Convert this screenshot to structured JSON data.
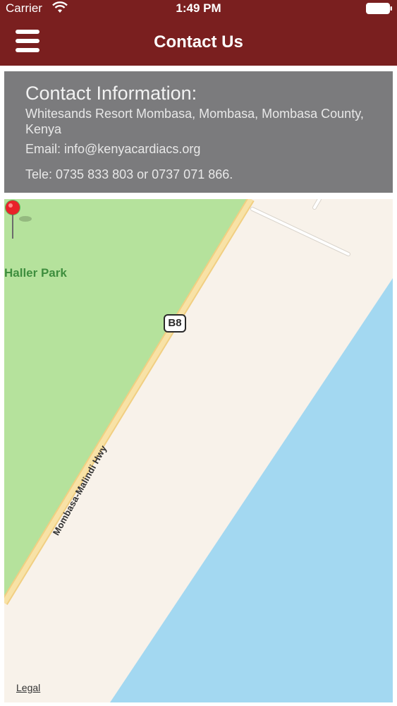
{
  "status_bar": {
    "carrier": "Carrier",
    "time": "1:49 PM"
  },
  "nav": {
    "title": "Contact Us",
    "menu_icon": "hamburger-menu-icon"
  },
  "contact": {
    "heading": "Contact Information:",
    "address": "Whitesands Resort Mombasa, Mombasa, Mombasa County, Kenya",
    "email": "Email: info@kenyacardiacs.org",
    "phone": "Tele: 0735 833 803 or 0737 071 866."
  },
  "map": {
    "park_label": "Haller Park",
    "route_shield": "B8",
    "road_label": "Mombasa-Malindi Hwy",
    "legal_label": "Legal",
    "pin_icon": "map-pin-icon"
  },
  "colors": {
    "nav_bg": "#7a1f1f",
    "card_bg": "#7b7b7d",
    "park_green": "#b5e29c",
    "water_blue": "#a3d8f1",
    "land": "#f8f2ea",
    "road": "#f7dc8e",
    "pin_red": "#e8222a"
  }
}
